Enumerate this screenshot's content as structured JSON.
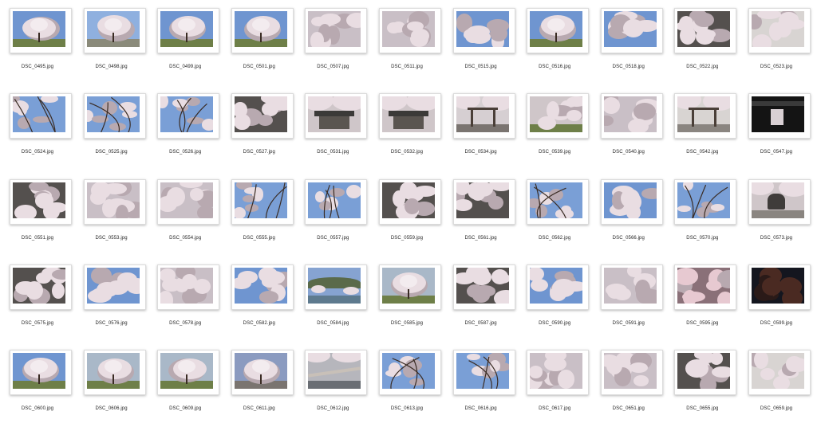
{
  "files": [
    {
      "name": "DSC_0495.jpg",
      "theme": "tree-blue-sky"
    },
    {
      "name": "DSC_0498.jpg",
      "theme": "tree-building"
    },
    {
      "name": "DSC_0499.jpg",
      "theme": "tree-blue-sky"
    },
    {
      "name": "DSC_0501.jpg",
      "theme": "tree-blue-sky"
    },
    {
      "name": "DSC_0507.jpg",
      "theme": "blossom-dense"
    },
    {
      "name": "DSC_0511.jpg",
      "theme": "blossom-dense"
    },
    {
      "name": "DSC_0515.jpg",
      "theme": "blossom-sky"
    },
    {
      "name": "DSC_0516.jpg",
      "theme": "tree-blue-sky"
    },
    {
      "name": "DSC_0518.jpg",
      "theme": "blossom-sky"
    },
    {
      "name": "DSC_0522.jpg",
      "theme": "blossom-dark"
    },
    {
      "name": "DSC_0523.jpg",
      "theme": "blossom-pale"
    },
    {
      "name": "DSC_0524.jpg",
      "theme": "branches-sky"
    },
    {
      "name": "DSC_0525.jpg",
      "theme": "branches-sky"
    },
    {
      "name": "DSC_0526.jpg",
      "theme": "branches-sky"
    },
    {
      "name": "DSC_0527.jpg",
      "theme": "blossom-dark"
    },
    {
      "name": "DSC_0531.jpg",
      "theme": "temple"
    },
    {
      "name": "DSC_0532.jpg",
      "theme": "temple"
    },
    {
      "name": "DSC_0534.jpg",
      "theme": "temple-gate"
    },
    {
      "name": "DSC_0539.jpg",
      "theme": "blossom-park"
    },
    {
      "name": "DSC_0540.jpg",
      "theme": "blossom-dense"
    },
    {
      "name": "DSC_0542.jpg",
      "theme": "torii"
    },
    {
      "name": "DSC_0547.jpg",
      "theme": "dark-gate"
    },
    {
      "name": "DSC_0551.jpg",
      "theme": "blossom-dark"
    },
    {
      "name": "DSC_0553.jpg",
      "theme": "blossom-dense"
    },
    {
      "name": "DSC_0554.jpg",
      "theme": "blossom-dense"
    },
    {
      "name": "DSC_0555.jpg",
      "theme": "branches-sky"
    },
    {
      "name": "DSC_0557.jpg",
      "theme": "branches-sky"
    },
    {
      "name": "DSC_0559.jpg",
      "theme": "blossom-dark"
    },
    {
      "name": "DSC_0561.jpg",
      "theme": "blossom-dark"
    },
    {
      "name": "DSC_0562.jpg",
      "theme": "branches-sky"
    },
    {
      "name": "DSC_0566.jpg",
      "theme": "blossom-sky"
    },
    {
      "name": "DSC_0570.jpg",
      "theme": "branches-sky"
    },
    {
      "name": "DSC_0573.jpg",
      "theme": "stone"
    },
    {
      "name": "DSC_0575.jpg",
      "theme": "blossom-dark"
    },
    {
      "name": "DSC_0576.jpg",
      "theme": "blossom-sky"
    },
    {
      "name": "DSC_0578.jpg",
      "theme": "blossom-dense"
    },
    {
      "name": "DSC_0582.jpg",
      "theme": "blossom-sky"
    },
    {
      "name": "DSC_0584.jpg",
      "theme": "lake"
    },
    {
      "name": "DSC_0585.jpg",
      "theme": "tree-park"
    },
    {
      "name": "DSC_0587.jpg",
      "theme": "blossom-dark"
    },
    {
      "name": "DSC_0590.jpg",
      "theme": "blossom-sky"
    },
    {
      "name": "DSC_0591.jpg",
      "theme": "blossom-dense"
    },
    {
      "name": "DSC_0595.jpg",
      "theme": "blossom-pink"
    },
    {
      "name": "DSC_0599.jpg",
      "theme": "night"
    },
    {
      "name": "DSC_0600.jpg",
      "theme": "tree-blue-sky"
    },
    {
      "name": "DSC_0606.jpg",
      "theme": "tree-park"
    },
    {
      "name": "DSC_0609.jpg",
      "theme": "tree-park"
    },
    {
      "name": "DSC_0611.jpg",
      "theme": "blossom-street"
    },
    {
      "name": "DSC_0612.jpg",
      "theme": "bridge"
    },
    {
      "name": "DSC_0613.jpg",
      "theme": "branches-sky"
    },
    {
      "name": "DSC_0616.jpg",
      "theme": "branches-sky"
    },
    {
      "name": "DSC_0617.jpg",
      "theme": "blossom-dense"
    },
    {
      "name": "DSC_0651.jpg",
      "theme": "blossom-dense"
    },
    {
      "name": "DSC_0655.jpg",
      "theme": "blossom-dark"
    },
    {
      "name": "DSC_0659.jpg",
      "theme": "blossom-pale"
    }
  ],
  "colors": {
    "sky": "#6f95d0",
    "blossom": "#e9dde2",
    "blossom_shadow": "#b8a9b0",
    "branch": "#3a2c24",
    "grass": "#6e7f48",
    "dark": "#2a2a2e",
    "night": "#14161f"
  }
}
